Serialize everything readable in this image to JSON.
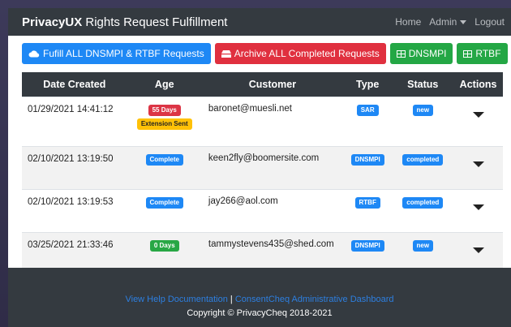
{
  "navbar": {
    "brand_bold": "PrivacyUX",
    "brand_rest": " Rights Request Fulfillment",
    "links": [
      "Home",
      "Admin",
      "Logout"
    ]
  },
  "actions": {
    "fulfill_label": "Fufill ALL DNSMPI & RTBF Requests",
    "archive_label": "Archive ALL Completed Requests",
    "dnsmpi_label": "DNSMPI",
    "rtbf_label": "RTBF"
  },
  "table": {
    "headers": [
      "Date Created",
      "Age",
      "Customer",
      "Type",
      "Status",
      "Actions"
    ],
    "rows": [
      {
        "date": "01/29/2021 14:41:12",
        "age": "55 Days",
        "age_extra": "Extension Sent",
        "customer": "baronet@muesli.net",
        "type": "SAR",
        "status": "new"
      },
      {
        "date": "02/10/2021 13:19:50",
        "age": "Complete",
        "customer": "keen2fly@boomersite.com",
        "type": "DNSMPI",
        "status": "completed"
      },
      {
        "date": "02/10/2021 13:19:53",
        "age": "Complete",
        "customer": "jay266@aol.com",
        "type": "RTBF",
        "status": "completed"
      },
      {
        "date": "03/25/2021 21:33:46",
        "age": "0 Days",
        "customer": "tammystevens435@shed.com",
        "type": "DNSMPI",
        "status": "new"
      }
    ]
  },
  "footer": {
    "help_link": "View Help Documentation",
    "separator": "|",
    "dashboard_link": "ConsentCheq Administrative Dashboard",
    "copyright": "Copyright © PrivacyCheq 2018-2021"
  },
  "colors": {
    "navbar": "#343a40",
    "primary": "#1e88f5",
    "danger": "#e0303f",
    "success": "#24a745",
    "warning": "#ffc107"
  }
}
